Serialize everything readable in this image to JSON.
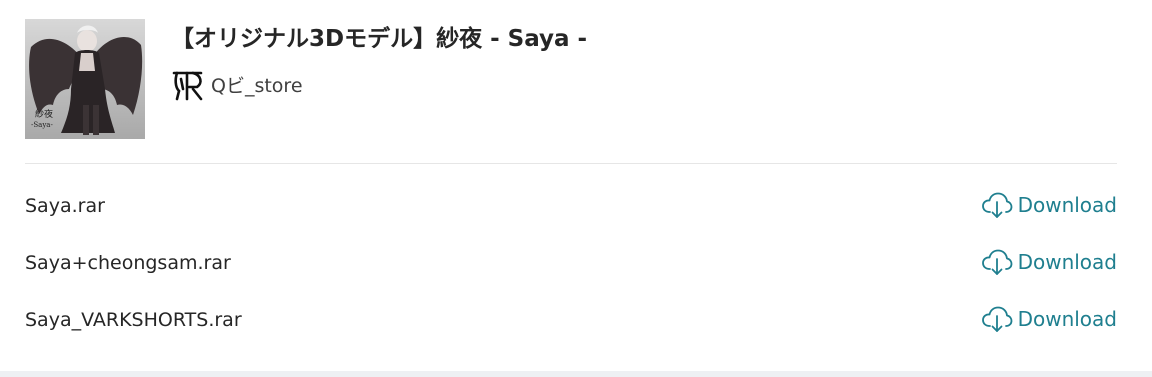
{
  "product": {
    "title": "【オリジナル3Dモデル】紗夜 - Saya -",
    "thumbnail_caption": "紗夜",
    "thumbnail_subcaption": "-Saya-"
  },
  "shop": {
    "name": "Qビ_store",
    "logo_icon": "shop-logo-icon"
  },
  "files": [
    {
      "name": "Saya.rar",
      "action_label": "Download"
    },
    {
      "name": "Saya+cheongsam.rar",
      "action_label": "Download"
    },
    {
      "name": "Saya_VARKSHORTS.rar",
      "action_label": "Download"
    }
  ],
  "colors": {
    "accent": "#1f7f8f",
    "text": "#262626",
    "divider": "#e6e6e6"
  }
}
